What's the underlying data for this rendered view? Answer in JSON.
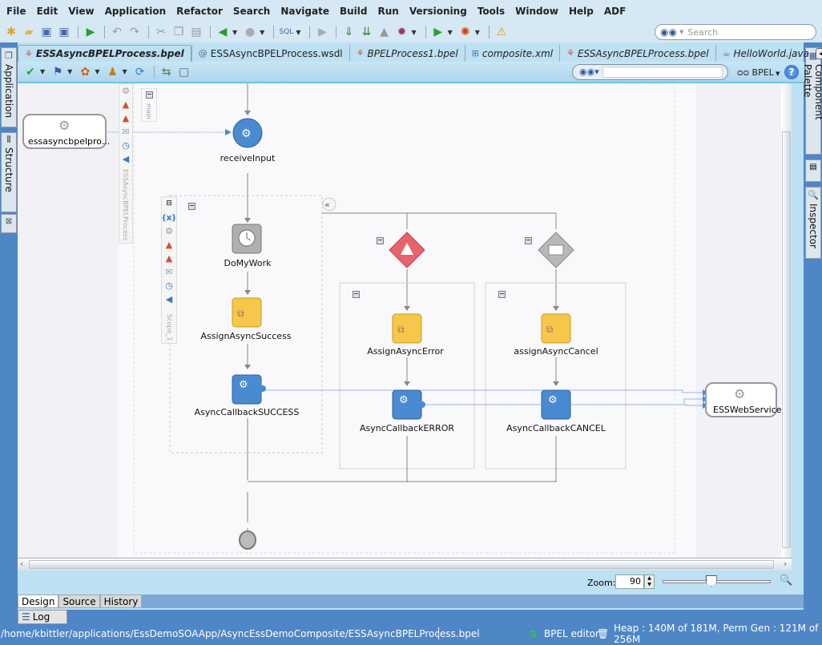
{
  "menubar": {
    "items": [
      {
        "label": "File",
        "accel": "F"
      },
      {
        "label": "Edit",
        "accel": "E"
      },
      {
        "label": "View",
        "accel": "V"
      },
      {
        "label": "Application",
        "accel": "A"
      },
      {
        "label": "Refactor",
        "accel": "t"
      },
      {
        "label": "Search",
        "accel": "S"
      },
      {
        "label": "Navigate",
        "accel": "N"
      },
      {
        "label": "Build",
        "accel": "B"
      },
      {
        "label": "Run",
        "accel": "R"
      },
      {
        "label": "Versioning",
        "accel": "o"
      },
      {
        "label": "Tools",
        "accel": "T"
      },
      {
        "label": "Window",
        "accel": "W"
      },
      {
        "label": "Help",
        "accel": "H"
      },
      {
        "label": "ADF",
        "accel": ""
      }
    ]
  },
  "toolbar": {
    "icons": [
      "new-icon",
      "open-icon",
      "save-icon",
      "save-all-icon",
      "run-icon",
      "undo-icon",
      "redo-icon",
      "cut-icon",
      "copy-icon",
      "paste-icon",
      "back-icon",
      "forward-icon",
      "sql-icon",
      "debug-run-icon",
      "make-icon",
      "rebuild-icon",
      "deploy-icon",
      "profile-icon",
      "run-project-icon",
      "debug-bug-icon",
      "warning-icon"
    ],
    "search_placeholder": "Search"
  },
  "left_panel_tabs": [
    "Application",
    "Structure"
  ],
  "right_panel_tabs": [
    "Component Palette",
    "Inspector"
  ],
  "file_tabs": [
    {
      "label": "ESSAsyncBPELProcess.bpel",
      "icon": "bpel-icon",
      "active": true
    },
    {
      "label": "ESSAsyncBPELProcess.wsdl",
      "icon": "wsdl-icon",
      "active": false
    },
    {
      "label": "BPELProcess1.bpel",
      "icon": "bpel-icon",
      "active": false
    },
    {
      "label": "composite.xml",
      "icon": "composite-icon",
      "active": false
    },
    {
      "label": "ESSAsyncBPELProcess.bpel",
      "icon": "bpel-icon",
      "active": false
    },
    {
      "label": "HelloWorld.java",
      "icon": "java-icon",
      "active": false
    }
  ],
  "editor_toolbar": {
    "language_label": "BPEL",
    "find_value": ""
  },
  "diagram": {
    "partner_left": "essasyncbpelpro...",
    "partner_right": "ESSWebService",
    "process_label": "ESSAsyncBPELProcess",
    "main_label": "main",
    "scope_label": "Scope_1",
    "activities": {
      "receive": "receiveInput",
      "wait": "DoMyWork",
      "assign_success": "AssignAsyncSuccess",
      "invoke_success": "AsyncCallbackSUCCESS",
      "assign_error": "AssignAsyncError",
      "invoke_error": "AsyncCallbackERROR",
      "assign_cancel": "assignAsyncCancel",
      "invoke_cancel": "AsyncCallbackCANCEL"
    }
  },
  "zoom": {
    "label": "Zoom:",
    "value": "90",
    "slider_fraction": 0.45
  },
  "bottom_tabs": [
    {
      "label": "Design",
      "active": true
    },
    {
      "label": "Source",
      "active": false
    },
    {
      "label": "History",
      "active": false
    }
  ],
  "log_tab": "Log",
  "statusbar": {
    "path": "/home/kbittler/applications/EssDemoSOAApp/AsyncEssDemoComposite/ESSAsyncBPELProcess.bpel",
    "editor": "BPEL editor",
    "memory": "Heap : 140M of 181M, Perm Gen : 121M of 256M"
  },
  "colors": {
    "accent": "#4f86c6",
    "panel": "#bde0f2",
    "invoke": "#4a8ad0",
    "assign": "#f5c84a",
    "catch": "#e8636b"
  }
}
